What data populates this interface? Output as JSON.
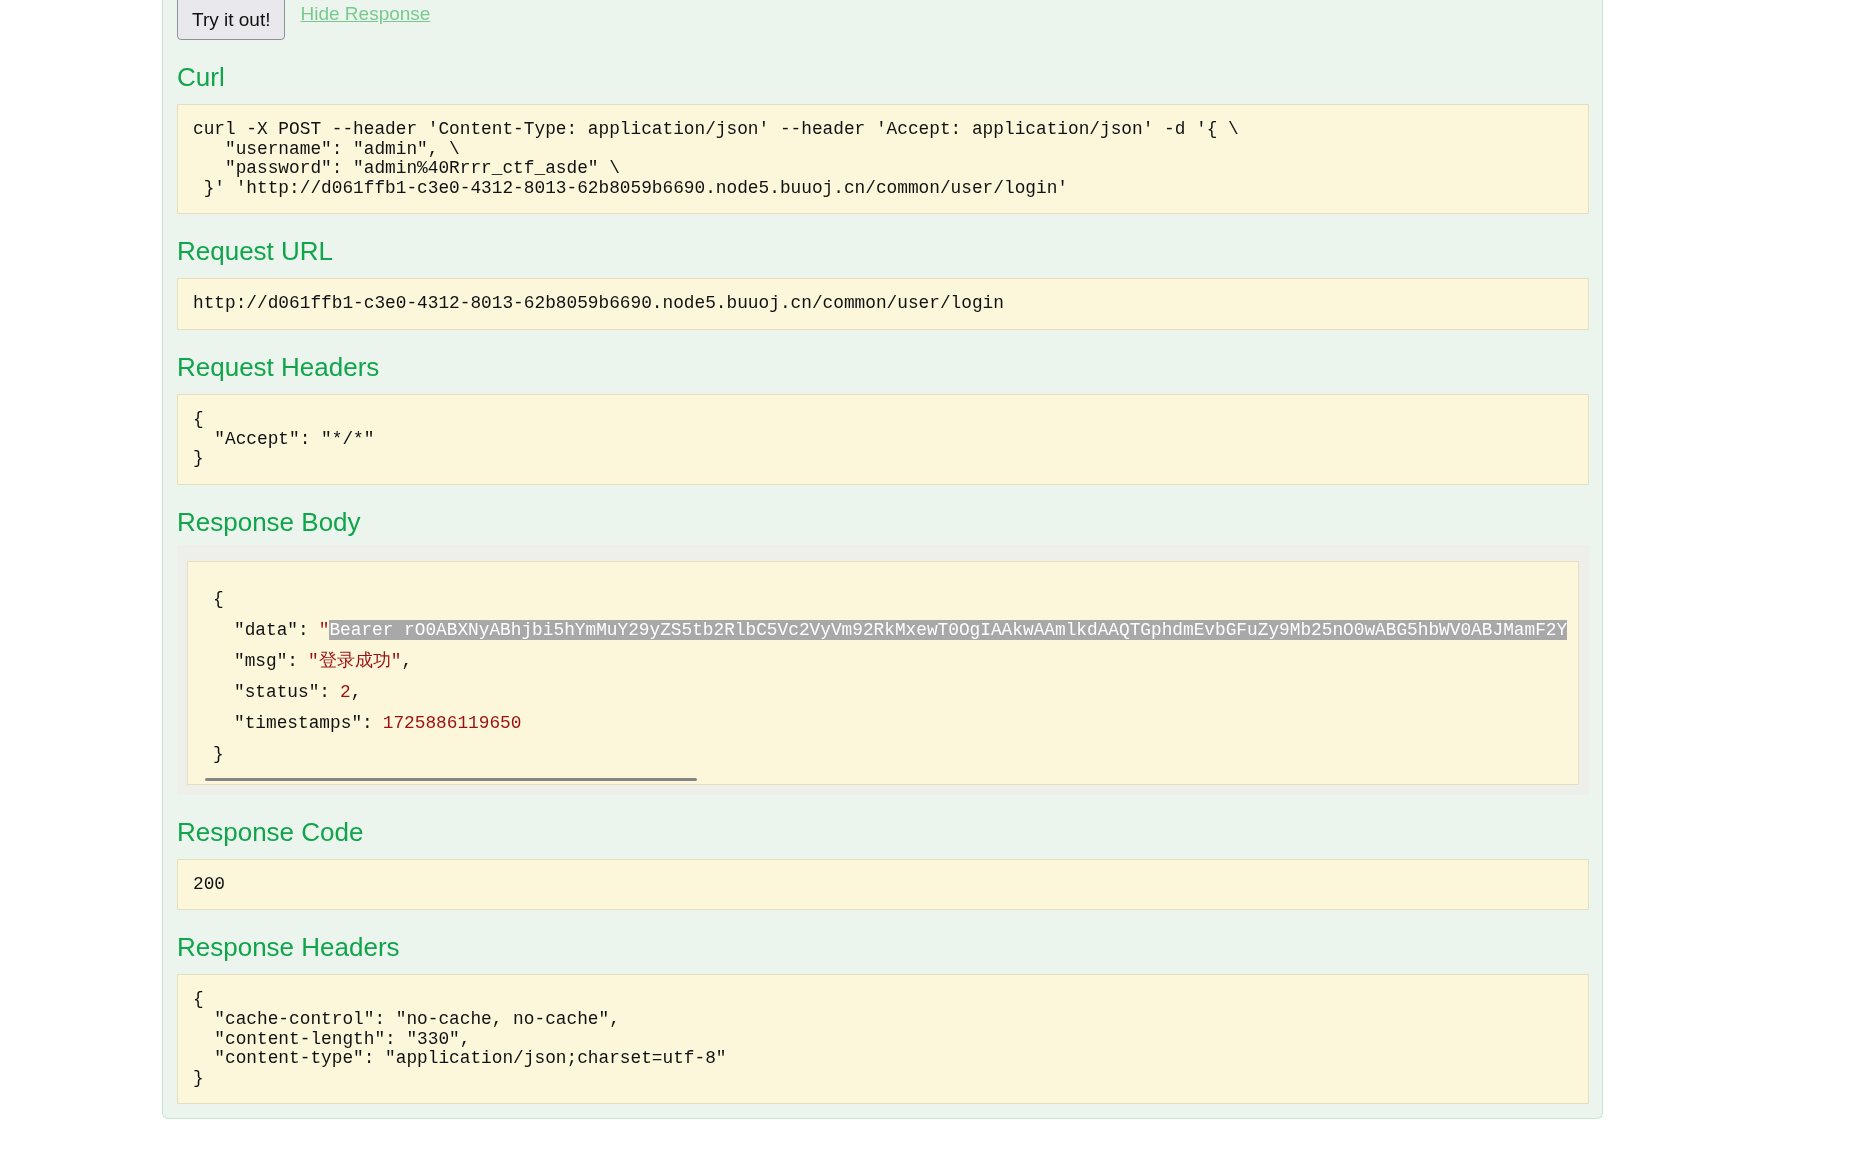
{
  "actions": {
    "try_button": "Try it out!",
    "hide_link": "Hide Response"
  },
  "curl": {
    "heading": "Curl",
    "lines": [
      "curl -X POST --header 'Content-Type: application/json' --header 'Accept: application/json' -d '{ \\",
      "   \"username\": \"admin\", \\",
      "   \"password\": \"admin%40Rrrr_ctf_asde\" \\",
      " }' 'http://d061ffb1-c3e0-4312-8013-62b8059b6690.node5.buuoj.cn/common/user/login'"
    ]
  },
  "request_url": {
    "heading": "Request URL",
    "lines": [
      "http://d061ffb1-c3e0-4312-8013-62b8059b6690.node5.buuoj.cn/common/user/login"
    ]
  },
  "request_headers": {
    "heading": "Request Headers",
    "lines": [
      "{",
      "  \"Accept\": \"*/*\"",
      "}"
    ]
  },
  "response_body": {
    "heading": "Response Body",
    "open": "{",
    "close": "}",
    "fields": [
      {
        "key": "\"data\":",
        "parts": [
          {
            "text": "\"",
            "highlighted": false
          },
          {
            "text": "Bearer rO0ABXNyABhjbi5hYmMuY29yZS5tb2RlbC5Vc2VyVm92RkMxewT0OgIAAkwAAmlkdAAQTGphdmEvbGFuZy9Mb25nO0wABG5hbWV0ABJMamF2Y",
            "highlighted": true
          }
        ]
      },
      {
        "key": "\"msg\":",
        "parts": [
          {
            "text": "\"登录成功\"",
            "highlighted": false
          }
        ],
        "separator": ","
      },
      {
        "key": "\"status\":",
        "parts": [
          {
            "text": "2",
            "highlighted": false
          }
        ],
        "separator": ","
      },
      {
        "key": "\"timestamps\":",
        "parts": [
          {
            "text": "1725886119650",
            "highlighted": false
          }
        ]
      }
    ]
  },
  "response_code": {
    "heading": "Response Code",
    "lines": [
      "200"
    ]
  },
  "response_headers": {
    "heading": "Response Headers",
    "lines": [
      "{",
      "  \"cache-control\": \"no-cache, no-cache\",",
      "  \"content-length\": \"330\",",
      "  \"content-type\": \"application/json;charset=utf-8\"",
      "}"
    ]
  }
}
